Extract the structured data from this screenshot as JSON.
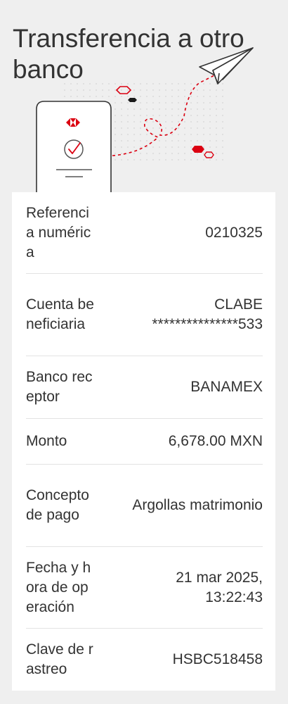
{
  "header": {
    "title": "Transferencia a otro banco"
  },
  "illustration": {
    "icons": [
      "hsbc-logo-icon",
      "check-circle-icon",
      "paper-plane-icon"
    ],
    "accent_color": "#db0011"
  },
  "details": {
    "rows": [
      {
        "label": "Referencia numérica",
        "value": [
          "0210325"
        ]
      },
      {
        "label": "Cuenta beneficiaria",
        "value": [
          "CLABE",
          "***************533"
        ]
      },
      {
        "label": "Banco receptor",
        "value": [
          "BANAMEX"
        ]
      },
      {
        "label": "Monto",
        "value": [
          "6,678.00 MXN"
        ]
      },
      {
        "label": "Concepto de pago",
        "value": [
          "Argollas matrimonio"
        ]
      },
      {
        "label": "Fecha y hora de operación",
        "value": [
          "21 mar 2025,",
          "13:22:43"
        ]
      },
      {
        "label": "Clave de rastreo",
        "value": [
          "HSBC518458"
        ]
      }
    ]
  },
  "colors": {
    "background": "#efefef",
    "card": "#ffffff",
    "text": "#333333",
    "brand_red": "#db0011"
  }
}
